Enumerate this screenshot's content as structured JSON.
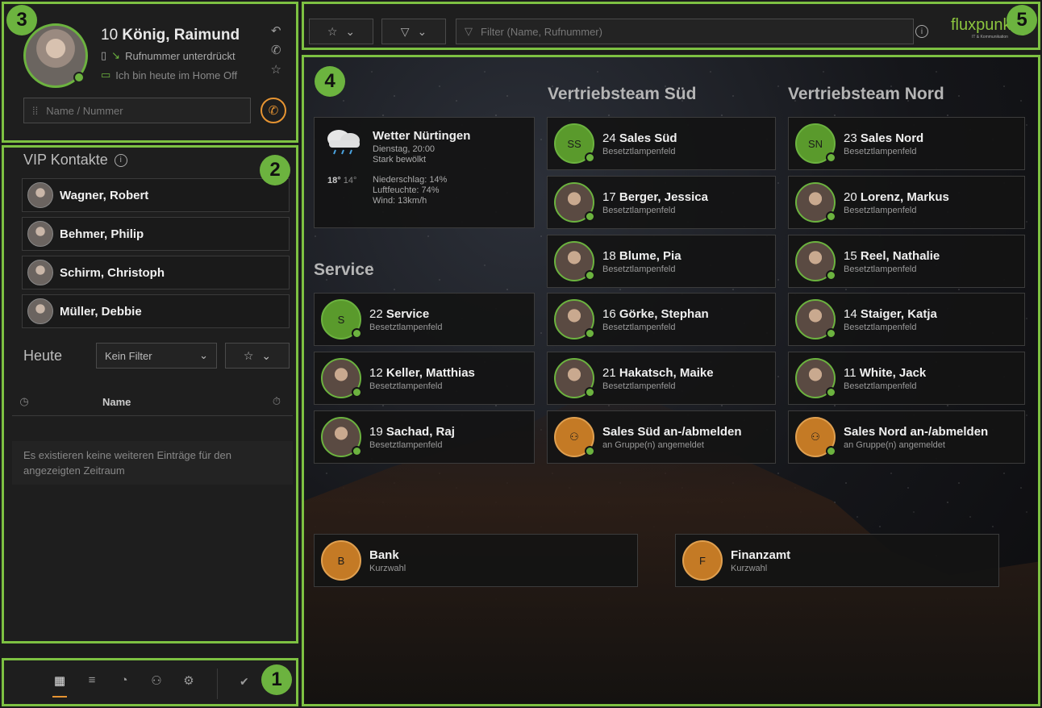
{
  "profile": {
    "extension": "10",
    "name": "König, Raimund",
    "number_status": "Rufnummer unterdrückt",
    "status_message": "Ich bin heute im Home Off",
    "search_placeholder": "Name / Nummer"
  },
  "vip": {
    "title": "VIP Kontakte",
    "items": [
      {
        "name": "Wagner, Robert"
      },
      {
        "name": "Behmer, Philip"
      },
      {
        "name": "Schirm, Christoph"
      },
      {
        "name": "Müller, Debbie"
      }
    ],
    "today_label": "Heute",
    "filter_value": "Kein Filter",
    "column_name": "Name",
    "empty_message": "Es existieren keine weiteren Einträge für den angezeigten Zeitraum"
  },
  "toolbar": {
    "filter_placeholder": "Filter (Name, Rufnummer)",
    "logo_text": "fluxpunkt",
    "logo_sub": "IT & Kommunikation"
  },
  "badges": [
    "1",
    "2",
    "3",
    "4",
    "5"
  ],
  "board": {
    "groups": {
      "sued": "Vertriebsteam Süd",
      "nord": "Vertriebsteam Nord",
      "service": "Service"
    },
    "weather": {
      "title": "Wetter Nürtingen",
      "date": "Dienstag, 20:00",
      "condition": "Stark bewölkt",
      "temp_high": "18°",
      "temp_low": "14°",
      "precip": "Niederschlag: 14%",
      "humidity": "Luftfeuchte: 74%",
      "wind": "Wind: 13km/h"
    },
    "service_cards": [
      {
        "ext": "22",
        "name": "Service",
        "sub": "Besetztlampenfeld",
        "initials": "S"
      },
      {
        "ext": "12",
        "name": "Keller, Matthias",
        "sub": "Besetztlampenfeld"
      },
      {
        "ext": "19",
        "name": "Sachad, Raj",
        "sub": "Besetztlampenfeld"
      }
    ],
    "sued_cards": [
      {
        "ext": "24",
        "name": "Sales Süd",
        "sub": "Besetztlampenfeld",
        "initials": "SS"
      },
      {
        "ext": "17",
        "name": "Berger, Jessica",
        "sub": "Besetztlampenfeld"
      },
      {
        "ext": "18",
        "name": "Blume, Pia",
        "sub": "Besetztlampenfeld"
      },
      {
        "ext": "16",
        "name": "Görke, Stephan",
        "sub": "Besetztlampenfeld"
      },
      {
        "ext": "21",
        "name": "Hakatsch, Maike",
        "sub": "Besetztlampenfeld"
      },
      {
        "ext": "",
        "name": "Sales Süd an-/abmelden",
        "sub": "an Gruppe(n) angemeldet"
      }
    ],
    "nord_cards": [
      {
        "ext": "23",
        "name": "Sales Nord",
        "sub": "Besetztlampenfeld",
        "initials": "SN"
      },
      {
        "ext": "20",
        "name": "Lorenz, Markus",
        "sub": "Besetztlampenfeld"
      },
      {
        "ext": "15",
        "name": "Reel, Nathalie",
        "sub": "Besetztlampenfeld"
      },
      {
        "ext": "14",
        "name": "Staiger, Katja",
        "sub": "Besetztlampenfeld"
      },
      {
        "ext": "11",
        "name": "White, Jack",
        "sub": "Besetztlampenfeld"
      },
      {
        "ext": "",
        "name": "Sales Nord an-/abmelden",
        "sub": "an Gruppe(n) angemeldet"
      }
    ],
    "speed_dials": [
      {
        "name": "Bank",
        "sub": "Kurzwahl",
        "initials": "B"
      },
      {
        "name": "Finanzamt",
        "sub": "Kurzwahl",
        "initials": "F"
      }
    ]
  },
  "colors": {
    "accent_green": "#6cb33f",
    "accent_orange": "#e69432",
    "highlight_border": "#7dc142"
  }
}
